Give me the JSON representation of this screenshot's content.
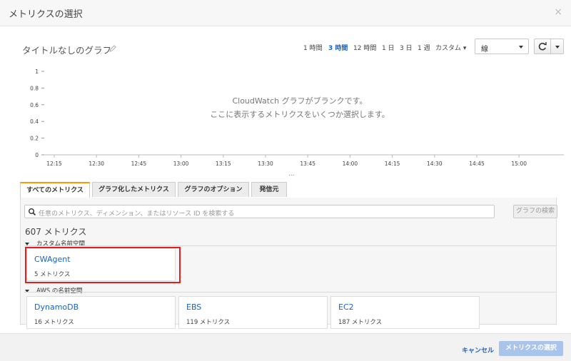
{
  "modal": {
    "title": "メトリクスの選択",
    "close": "×"
  },
  "graph": {
    "title": "タイトルなしのグラフ",
    "time_ranges": [
      {
        "label": "1 時間",
        "active": false
      },
      {
        "label": "3 時間",
        "active": true
      },
      {
        "label": "12 時間",
        "active": false
      },
      {
        "label": "1 日",
        "active": false
      },
      {
        "label": "3 日",
        "active": false
      },
      {
        "label": "1 週",
        "active": false
      },
      {
        "label": "カスタム ▾",
        "active": false
      }
    ],
    "graph_type": "線",
    "blank_line1": "CloudWatch グラフがブランクです。",
    "blank_line2": "ここに表示するメトリクスをいくつか選択します。",
    "resize_handle": "..."
  },
  "chart_data": {
    "type": "line",
    "series": [],
    "y_ticks": [
      "1",
      "0.8",
      "0.6",
      "0.4",
      "0.2",
      "0"
    ],
    "x_ticks": [
      "12:15",
      "12:30",
      "12:45",
      "13:00",
      "13:15",
      "13:30",
      "13:45",
      "14:00",
      "14:15",
      "14:30",
      "14:45",
      "15:00"
    ],
    "ylim": [
      0,
      1
    ],
    "grid": false
  },
  "tabs": [
    {
      "label": "すべてのメトリクス",
      "active": true
    },
    {
      "label": "グラフ化したメトリクス",
      "active": false
    },
    {
      "label": "グラフのオプション",
      "active": false
    },
    {
      "label": "発信元",
      "active": false
    }
  ],
  "search": {
    "placeholder": "任意のメトリクス、ディメンション、またはリソース ID を検索する",
    "button": "グラフの検索"
  },
  "metrics": {
    "count": "607 メトリクス",
    "custom_section": "カスタム名前空間",
    "aws_section": "AWS の名前空間",
    "custom": [
      {
        "name": "CWAgent",
        "count": "5 メトリクス"
      }
    ],
    "aws": [
      {
        "name": "DynamoDB",
        "count": "16 メトリクス"
      },
      {
        "name": "EBS",
        "count": "119 メトリクス"
      },
      {
        "name": "EC2",
        "count": "187 メトリクス"
      }
    ]
  },
  "footer": {
    "cancel": "キャンセル",
    "select": "メトリクスの選択"
  },
  "colors": {
    "link": "#1a64c0",
    "active_tab": "#ff9900",
    "highlight": "#e02020",
    "primary_disabled": "#a9c4ea"
  }
}
